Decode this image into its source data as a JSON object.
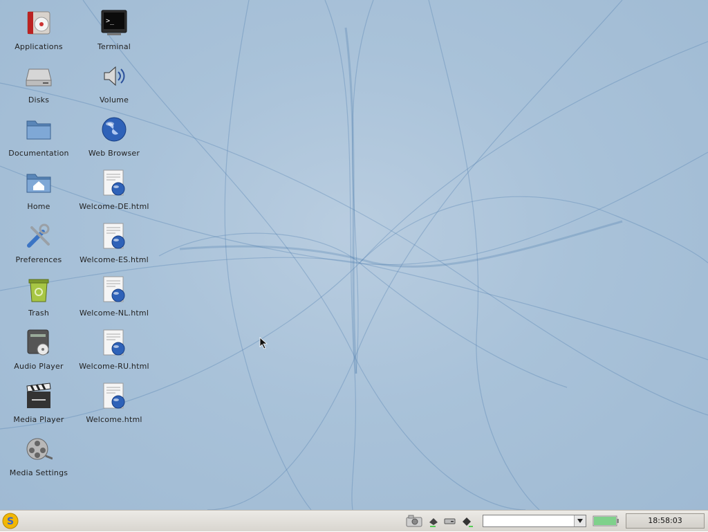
{
  "desktop": {
    "icons_col1": [
      {
        "label": "Applications",
        "icon": "applications-icon"
      },
      {
        "label": "Disks",
        "icon": "disk-drive-icon"
      },
      {
        "label": "Documentation",
        "icon": "folder-icon"
      },
      {
        "label": "Home",
        "icon": "home-folder-icon"
      },
      {
        "label": "Preferences",
        "icon": "preferences-tools-icon"
      },
      {
        "label": "Trash",
        "icon": "trash-icon"
      },
      {
        "label": "Audio Player",
        "icon": "audio-player-icon"
      },
      {
        "label": "Media Player",
        "icon": "clapperboard-icon"
      },
      {
        "label": "Media Settings",
        "icon": "film-reel-icon"
      }
    ],
    "icons_col2": [
      {
        "label": "Terminal",
        "icon": "terminal-icon"
      },
      {
        "label": "Volume",
        "icon": "speaker-icon"
      },
      {
        "label": "Web Browser",
        "icon": "globe-icon"
      },
      {
        "label": "Welcome-DE.html",
        "icon": "html-document-icon"
      },
      {
        "label": "Welcome-ES.html",
        "icon": "html-document-icon"
      },
      {
        "label": "Welcome-NL.html",
        "icon": "html-document-icon"
      },
      {
        "label": "Welcome-RU.html",
        "icon": "html-document-icon"
      },
      {
        "label": "Welcome.html",
        "icon": "html-document-icon"
      }
    ]
  },
  "taskbar": {
    "clock": "18:58:03",
    "app_selector_value": "",
    "battery_level": 1.0,
    "colors": {
      "battery": "#7fd18b",
      "start": "#f2b705"
    }
  }
}
